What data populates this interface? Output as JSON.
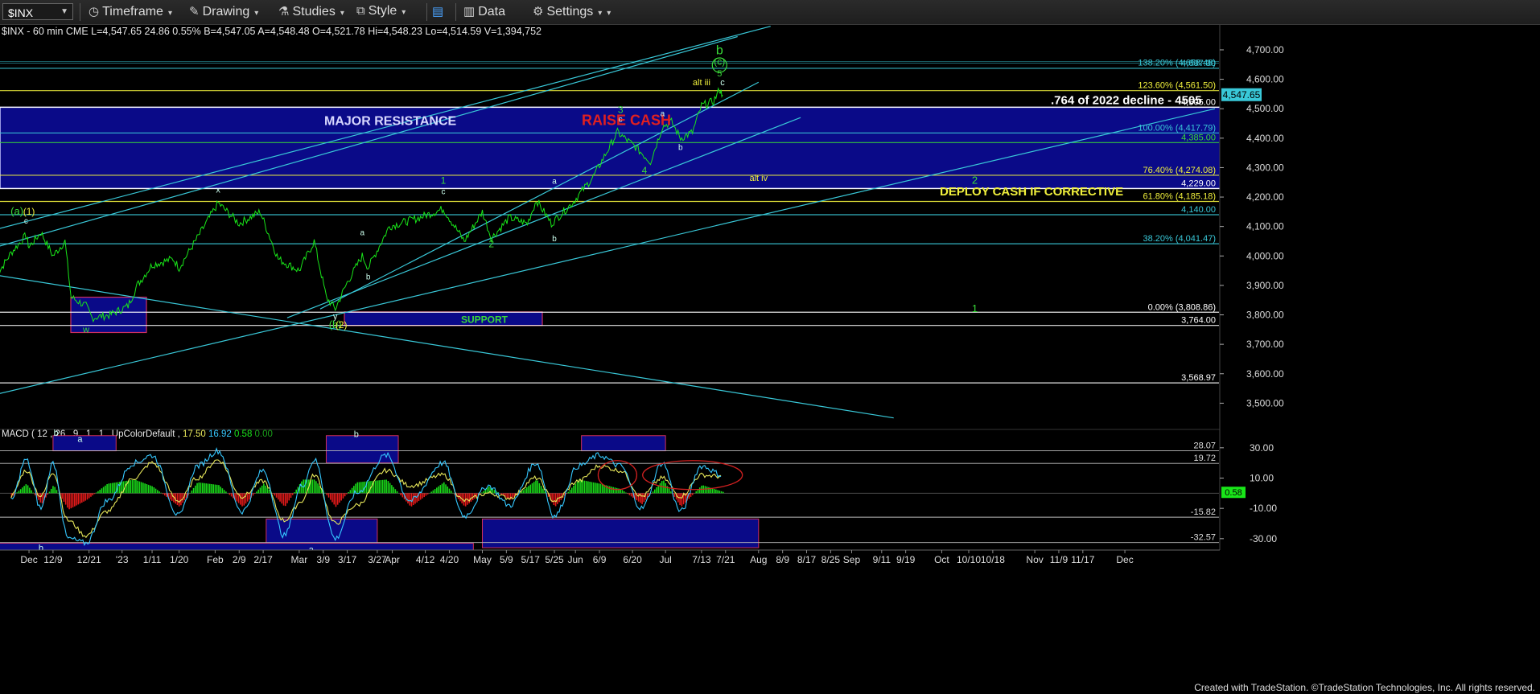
{
  "toolbar": {
    "symbol": "$INX",
    "items": [
      "Timeframe",
      "Drawing",
      "Studies",
      "Style",
      "Data",
      "Settings"
    ]
  },
  "quote_line": "$INX - 60 min  CME  L=4,547.65  24.86  0.55%  B=4,547.05  A=4,548.48  O=4,521.78  Hi=4,548.23  Lo=4,514.59  V=1,394,752",
  "macd_label": {
    "prefix": "MACD ( 12 , 26 , 9 , 1 , 1 , UpColorDefault ,",
    "v1": "17.50",
    "v2": "16.92",
    "v3": "0.58",
    "v4": "0.00"
  },
  "footer": "Created with TradeStation. ©TradeStation Technologies, Inc. All rights reserved.",
  "colors": {
    "price": "#19e619",
    "trendline": "#39c8d8",
    "zone": "#0a0a88",
    "macd_line": "#35c8ff",
    "signal": "#e8e85a",
    "hist_up": "#19d919",
    "hist_down": "#e61a1a",
    "label_green": "#39d939",
    "label_yellow": "#f0f03c"
  },
  "chart_data": [
    {
      "type": "line",
      "title": "$INX - 60 min",
      "x_range": [
        "2022-11-20",
        "2023-12-31"
      ],
      "ylim": [
        3430,
        4760
      ],
      "y_ticks": [
        "4,700.00",
        "4,600.00",
        "4,500.00",
        "4,400.00",
        "4,300.00",
        "4,200.00",
        "4,100.00",
        "4,000.00",
        "3,900.00",
        "3,800.00",
        "3,700.00",
        "3,600.00",
        "3,500.00"
      ],
      "y_tick_values": [
        4700,
        4600,
        4500,
        4400,
        4300,
        4200,
        4100,
        4000,
        3900,
        3800,
        3700,
        3600,
        3500
      ],
      "x_ticks": [
        "Dec",
        "12/9",
        "12/21",
        "'23",
        "1/11",
        "1/20",
        "Feb",
        "2/9",
        "2/17",
        "Mar",
        "3/9",
        "3/17",
        "3/27",
        "Apr",
        "4/12",
        "4/20",
        "May",
        "5/9",
        "5/17",
        "5/25",
        "Jun",
        "6/9",
        "6/20",
        "Jul",
        "7/13",
        "7/21",
        "Aug",
        "8/9",
        "8/17",
        "8/25",
        "Sep",
        "9/11",
        "9/19",
        "Oct",
        "10/10",
        "10/18",
        "Nov",
        "11/9",
        "11/17",
        "Dec"
      ],
      "x_tick_dates": [
        "2022-12-01",
        "2022-12-09",
        "2022-12-21",
        "2023-01-01",
        "2023-01-11",
        "2023-01-20",
        "2023-02-01",
        "2023-02-09",
        "2023-02-17",
        "2023-03-01",
        "2023-03-09",
        "2023-03-17",
        "2023-03-27",
        "2023-04-01",
        "2023-04-12",
        "2023-04-20",
        "2023-05-01",
        "2023-05-09",
        "2023-05-17",
        "2023-05-25",
        "2023-06-01",
        "2023-06-09",
        "2023-06-20",
        "2023-07-01",
        "2023-07-13",
        "2023-07-21",
        "2023-08-01",
        "2023-08-09",
        "2023-08-17",
        "2023-08-25",
        "2023-09-01",
        "2023-09-11",
        "2023-09-19",
        "2023-10-01",
        "2023-10-10",
        "2023-10-18",
        "2023-11-01",
        "2023-11-09",
        "2023-11-17",
        "2023-12-01"
      ],
      "series": [
        {
          "values": [
            [
              "2022-11-20",
              3930
            ],
            [
              "2022-11-25",
              4010
            ],
            [
              "2022-11-30",
              4070
            ],
            [
              "2022-12-01",
              4030
            ],
            [
              "2022-12-05",
              4080
            ],
            [
              "2022-12-09",
              4000
            ],
            [
              "2022-12-13",
              4050
            ],
            [
              "2022-12-15",
              3860
            ],
            [
              "2022-12-20",
              3830
            ],
            [
              "2022-12-22",
              3790
            ],
            [
              "2022-12-28",
              3800
            ],
            [
              "2023-01-03",
              3830
            ],
            [
              "2023-01-06",
              3900
            ],
            [
              "2023-01-11",
              3970
            ],
            [
              "2023-01-18",
              3990
            ],
            [
              "2023-01-20",
              3960
            ],
            [
              "2023-01-26",
              4060
            ],
            [
              "2023-02-02",
              4180
            ],
            [
              "2023-02-09",
              4110
            ],
            [
              "2023-02-16",
              4150
            ],
            [
              "2023-02-22",
              3990
            ],
            [
              "2023-03-01",
              3950
            ],
            [
              "2023-03-06",
              4050
            ],
            [
              "2023-03-10",
              3860
            ],
            [
              "2023-03-13",
              3820
            ],
            [
              "2023-03-17",
              3910
            ],
            [
              "2023-03-22",
              4000
            ],
            [
              "2023-03-24",
              3960
            ],
            [
              "2023-03-31",
              4100
            ],
            [
              "2023-04-10",
              4130
            ],
            [
              "2023-04-18",
              4160
            ],
            [
              "2023-04-25",
              4050
            ],
            [
              "2023-05-01",
              4150
            ],
            [
              "2023-05-04",
              4060
            ],
            [
              "2023-05-10",
              4130
            ],
            [
              "2023-05-16",
              4110
            ],
            [
              "2023-05-19",
              4190
            ],
            [
              "2023-05-24",
              4110
            ],
            [
              "2023-05-31",
              4180
            ],
            [
              "2023-06-07",
              4270
            ],
            [
              "2023-06-15",
              4420
            ],
            [
              "2023-06-21",
              4370
            ],
            [
              "2023-06-26",
              4320
            ],
            [
              "2023-06-30",
              4440
            ],
            [
              "2023-07-03",
              4455
            ],
            [
              "2023-07-06",
              4400
            ],
            [
              "2023-07-10",
              4420
            ],
            [
              "2023-07-13",
              4510
            ],
            [
              "2023-07-17",
              4525
            ],
            [
              "2023-07-19",
              4565
            ],
            [
              "2023-07-20",
              4547
            ]
          ]
        }
      ],
      "horizontal_levels": [
        {
          "value": 4637.3,
          "label": "4,637.30",
          "color": "#39c8d8"
        },
        {
          "value": 4561.5,
          "label": "123.60% (4,561.50)",
          "color": "#f0f03c"
        },
        {
          "value": 4505.0,
          "label": "4,505.00",
          "color": "#ffffff"
        },
        {
          "value": 4417.79,
          "label": "100.00% (4,417.79)",
          "color": "#39c8d8"
        },
        {
          "value": 4385.0,
          "label": "4,385.00",
          "color": "#39d939"
        },
        {
          "value": 4274.08,
          "label": "76.40% (4,274.08)",
          "color": "#f0f03c"
        },
        {
          "value": 4229.0,
          "label": "4,229.00",
          "color": "#ffffff"
        },
        {
          "value": 4185.18,
          "label": "61.80% (4,185.18)",
          "color": "#f0f03c"
        },
        {
          "value": 4140.0,
          "label": "4,140.00",
          "color": "#39c8d8"
        },
        {
          "value": 4041.47,
          "label": "38.20% (4,041.47)",
          "color": "#39c8d8"
        },
        {
          "value": 3808.86,
          "label": "0.00% (3,808.86)",
          "color": "#ffffff"
        },
        {
          "value": 3764.0,
          "label": "3,764.00",
          "color": "#ffffff"
        },
        {
          "value": 3568.97,
          "label": "3,568.97",
          "color": "#ffffff"
        }
      ],
      "fib_138_label": "138.20% (4,658.48)",
      "last_price_label": "4,547.65",
      "annotations": {
        "major_resistance": "MAJOR RESISTANCE",
        "raise_cash": "RAISE CASH",
        "decline_764": ".764 of 2022 decline - 4505",
        "deploy_cash": "DEPLOY CASH IF CORRECTIVE",
        "support": "SUPPORT",
        "wave_labels": [
          {
            "text": "b",
            "date": "2023-07-19",
            "y": 4685,
            "color": "#39d939",
            "size": 16
          },
          {
            "text": "(c)",
            "date": "2023-07-19",
            "y": 4650,
            "color": "#39d939",
            "size": 12
          },
          {
            "text": "5",
            "date": "2023-07-19",
            "y": 4610,
            "color": "#39d939",
            "size": 11
          },
          {
            "text": "alt iii",
            "date": "2023-07-13",
            "y": 4580,
            "color": "#f0f03c",
            "size": 11
          },
          {
            "text": "c",
            "date": "2023-07-20",
            "y": 4580,
            "color": "#cfe",
            "size": 11
          },
          {
            "text": "3",
            "date": "2023-06-16",
            "y": 4485,
            "color": "#39d939",
            "size": 12
          },
          {
            "text": "c",
            "date": "2023-06-16",
            "y": 4455,
            "color": "#cfe",
            "size": 10
          },
          {
            "text": "a",
            "date": "2023-06-30",
            "y": 4475,
            "color": "#cfe",
            "size": 10
          },
          {
            "text": "b",
            "date": "2023-07-06",
            "y": 4360,
            "color": "#cfe",
            "size": 10
          },
          {
            "text": "4",
            "date": "2023-06-24",
            "y": 4280,
            "color": "#39d939",
            "size": 12
          },
          {
            "text": "alt iv",
            "date": "2023-08-01",
            "y": 4255,
            "color": "#f0f03c",
            "size": 11
          },
          {
            "text": "2",
            "date": "2023-10-12",
            "y": 4245,
            "color": "#39d939",
            "size": 13
          },
          {
            "text": "1",
            "date": "2023-04-18",
            "y": 4245,
            "color": "#39d939",
            "size": 12
          },
          {
            "text": "c",
            "date": "2023-04-18",
            "y": 4210,
            "color": "#cfe",
            "size": 10
          },
          {
            "text": "a",
            "date": "2023-05-25",
            "y": 4245,
            "color": "#cfe",
            "size": 10
          },
          {
            "text": "b",
            "date": "2023-05-25",
            "y": 4050,
            "color": "#cfe",
            "size": 10
          },
          {
            "text": "2",
            "date": "2023-05-04",
            "y": 4030,
            "color": "#39d939",
            "size": 12
          },
          {
            "text": "a",
            "date": "2023-03-22",
            "y": 4070,
            "color": "#cfe",
            "size": 10
          },
          {
            "text": "b",
            "date": "2023-03-24",
            "y": 3920,
            "color": "#cfe",
            "size": 10
          },
          {
            "text": "x",
            "date": "2023-02-02",
            "y": 4215,
            "color": "#cfe",
            "size": 11
          },
          {
            "text": "y",
            "date": "2023-03-13",
            "y": 3785,
            "color": "#cfe",
            "size": 11
          },
          {
            "text": "(b)",
            "date": "2023-03-13",
            "y": 3755,
            "color": "#39d939",
            "size": 13
          },
          {
            "text": "(2)",
            "date": "2023-03-15",
            "y": 3755,
            "color": "#f0f03c",
            "size": 12
          },
          {
            "text": "(a)",
            "date": "2022-11-27",
            "y": 4140,
            "color": "#39d939",
            "size": 13
          },
          {
            "text": "(1)",
            "date": "2022-12-01",
            "y": 4140,
            "color": "#f0f03c",
            "size": 12
          },
          {
            "text": "c",
            "date": "2022-11-30",
            "y": 4110,
            "color": "#cfe",
            "size": 10
          },
          {
            "text": "w",
            "date": "2022-12-20",
            "y": 3740,
            "color": "#39d939",
            "size": 11
          },
          {
            "text": "1",
            "date": "2023-10-12",
            "y": 3810,
            "color": "#39d939",
            "size": 13
          }
        ]
      }
    },
    {
      "type": "line",
      "title": "MACD ( 12 , 26 , 9 , 1 , 1 , UpColorDefault ,",
      "ylim": [
        -37,
        40
      ],
      "y_ticks": [
        "30.00",
        "10.00",
        "-10.00",
        "-30.00"
      ],
      "y_tick_values": [
        30,
        10,
        -10,
        -30
      ],
      "levels": [
        {
          "value": 28.07,
          "label": "28.07"
        },
        {
          "value": 19.72,
          "label": "19.72"
        },
        {
          "value": -15.82,
          "label": "-15.82"
        },
        {
          "value": -32.57,
          "label": "-32.57"
        }
      ],
      "last_value_label": "0.58",
      "series": [
        {
          "name": "MACD",
          "values": [
            [
              "2022-11-25",
              -5
            ],
            [
              "2022-11-30",
              22
            ],
            [
              "2022-12-05",
              -10
            ],
            [
              "2022-12-09",
              20
            ],
            [
              "2022-12-14",
              -30
            ],
            [
              "2022-12-20",
              -33
            ],
            [
              "2022-12-27",
              -5
            ],
            [
              "2023-01-05",
              20
            ],
            [
              "2023-01-11",
              25
            ],
            [
              "2023-01-20",
              -15
            ],
            [
              "2023-01-26",
              18
            ],
            [
              "2023-02-02",
              28
            ],
            [
              "2023-02-10",
              -12
            ],
            [
              "2023-02-17",
              15
            ],
            [
              "2023-02-24",
              -28
            ],
            [
              "2023-03-02",
              5
            ],
            [
              "2023-03-06",
              22
            ],
            [
              "2023-03-13",
              -30
            ],
            [
              "2023-03-20",
              0
            ],
            [
              "2023-03-30",
              25
            ],
            [
              "2023-04-07",
              -5
            ],
            [
              "2023-04-18",
              20
            ],
            [
              "2023-04-25",
              -15
            ],
            [
              "2023-05-03",
              5
            ],
            [
              "2023-05-10",
              -8
            ],
            [
              "2023-05-19",
              20
            ],
            [
              "2023-05-25",
              -15
            ],
            [
              "2023-06-02",
              18
            ],
            [
              "2023-06-09",
              25
            ],
            [
              "2023-06-16",
              18
            ],
            [
              "2023-06-23",
              -10
            ],
            [
              "2023-06-30",
              20
            ],
            [
              "2023-07-06",
              -12
            ],
            [
              "2023-07-13",
              18
            ],
            [
              "2023-07-20",
              12
            ]
          ]
        },
        {
          "name": "Signal",
          "values": [
            [
              "2022-11-25",
              -2
            ],
            [
              "2022-11-30",
              15
            ],
            [
              "2022-12-05",
              -2
            ],
            [
              "2022-12-09",
              14
            ],
            [
              "2022-12-14",
              -18
            ],
            [
              "2022-12-20",
              -28
            ],
            [
              "2022-12-27",
              -12
            ],
            [
              "2023-01-05",
              10
            ],
            [
              "2023-01-11",
              20
            ],
            [
              "2023-01-20",
              -5
            ],
            [
              "2023-01-26",
              10
            ],
            [
              "2023-02-02",
              22
            ],
            [
              "2023-02-10",
              -2
            ],
            [
              "2023-02-17",
              8
            ],
            [
              "2023-02-24",
              -18
            ],
            [
              "2023-03-02",
              -5
            ],
            [
              "2023-03-06",
              12
            ],
            [
              "2023-03-13",
              -20
            ],
            [
              "2023-03-20",
              -8
            ],
            [
              "2023-03-30",
              15
            ],
            [
              "2023-04-07",
              5
            ],
            [
              "2023-04-18",
              12
            ],
            [
              "2023-04-25",
              -5
            ],
            [
              "2023-05-03",
              0
            ],
            [
              "2023-05-10",
              -3
            ],
            [
              "2023-05-19",
              10
            ],
            [
              "2023-05-25",
              -5
            ],
            [
              "2023-06-02",
              8
            ],
            [
              "2023-06-09",
              18
            ],
            [
              "2023-06-16",
              15
            ],
            [
              "2023-06-23",
              -2
            ],
            [
              "2023-06-30",
              10
            ],
            [
              "2023-07-06",
              -2
            ],
            [
              "2023-07-13",
              12
            ],
            [
              "2023-07-20",
              11
            ]
          ]
        }
      ],
      "annotations": [
        "a",
        "b",
        "b",
        "a",
        "b",
        "a"
      ]
    }
  ]
}
